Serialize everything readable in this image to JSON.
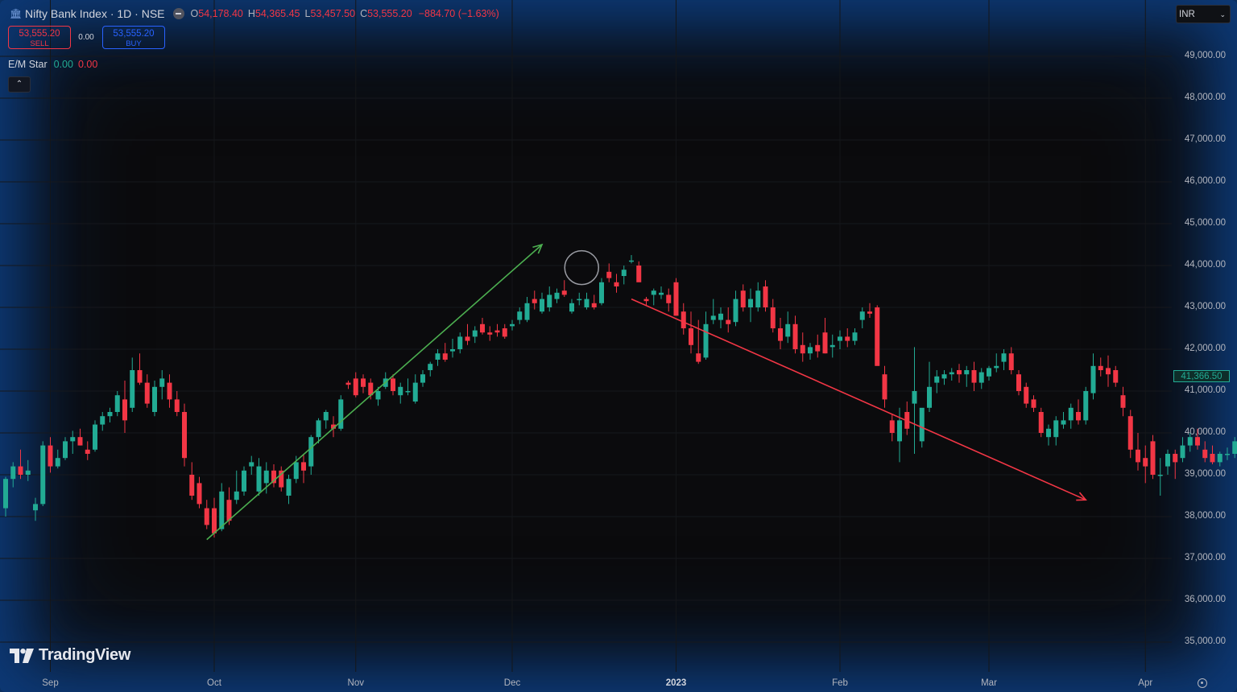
{
  "header": {
    "symbol_title": "Nifty Bank Index · 1D · NSE",
    "ohlc": {
      "o_label": "O",
      "o": "54,178.40",
      "h_label": "H",
      "h": "54,365.45",
      "l_label": "L",
      "l": "53,457.50",
      "c_label": "C",
      "c": "53,555.20",
      "change": "−884.70 (−1.63%)"
    }
  },
  "trade": {
    "sell_price": "53,555.20",
    "sell_label": "SELL",
    "spread": "0.00",
    "buy_price": "53,555.20",
    "buy_label": "BUY"
  },
  "indicator": {
    "name": "E/M Star",
    "value1": "0.00",
    "value2": "0.00"
  },
  "currency": {
    "label": "INR"
  },
  "last_price": "41,366.50",
  "logo": {
    "text": "TradingView"
  },
  "icons": [
    "bank-icon",
    "minus-icon",
    "chevron-up-icon",
    "chevron-down-icon",
    "tradingview-logo-icon",
    "settings-icon"
  ],
  "colors": {
    "up": "#22ab94",
    "down": "#f23645",
    "uptrend_arrow": "#4caf50",
    "downtrend_arrow": "#f23645",
    "background": "#0b0b0d",
    "frame_glow": "#0d3a78"
  },
  "chart_data": {
    "type": "candlestick",
    "y_ticks": [
      "49,000.00",
      "48,000.00",
      "47,000.00",
      "46,000.00",
      "45,000.00",
      "44,000.00",
      "43,000.00",
      "42,000.00",
      "41,000.00",
      "40,000.00",
      "39,000.00",
      "38,000.00",
      "37,000.00",
      "36,000.00",
      "35,000.00"
    ],
    "x_ticks": [
      "Sep",
      "Oct",
      "Nov",
      "Dec",
      "2023",
      "Feb",
      "Mar",
      "Apr"
    ],
    "ylim": [
      34200,
      49600
    ],
    "grid": true,
    "candles": [
      [
        38200,
        38950,
        38000,
        38900
      ],
      [
        38900,
        39300,
        38700,
        39200
      ],
      [
        39200,
        39600,
        38900,
        39000
      ],
      [
        39000,
        39350,
        38850,
        39100
      ],
      [
        38150,
        38450,
        37900,
        38300
      ],
      [
        38300,
        39800,
        38250,
        39700
      ],
      [
        39700,
        39900,
        39050,
        39200
      ],
      [
        39200,
        39600,
        39150,
        39400
      ],
      [
        39400,
        39900,
        39350,
        39800
      ],
      [
        39800,
        40050,
        39500,
        39900
      ],
      [
        39900,
        40100,
        39700,
        39700
      ],
      [
        39600,
        39800,
        39350,
        39500
      ],
      [
        39600,
        40300,
        39550,
        40200
      ],
      [
        40200,
        40500,
        40050,
        40400
      ],
      [
        40400,
        40600,
        40250,
        40500
      ],
      [
        40500,
        41000,
        40400,
        40900
      ],
      [
        40800,
        41250,
        40000,
        40300
      ],
      [
        40600,
        41800,
        40500,
        41500
      ],
      [
        41500,
        41900,
        41150,
        41200
      ],
      [
        41200,
        41400,
        40600,
        40700
      ],
      [
        40500,
        41250,
        40400,
        41100
      ],
      [
        41100,
        41500,
        40800,
        41300
      ],
      [
        41200,
        41400,
        40600,
        40800
      ],
      [
        40800,
        41000,
        40400,
        40500
      ],
      [
        40500,
        40700,
        39200,
        39400
      ],
      [
        39000,
        39300,
        38400,
        38500
      ],
      [
        38800,
        38950,
        38200,
        38300
      ],
      [
        38200,
        38400,
        37700,
        37800
      ],
      [
        38200,
        38450,
        37500,
        37600
      ],
      [
        37700,
        38800,
        37650,
        38600
      ],
      [
        38400,
        38700,
        37800,
        37900
      ],
      [
        38400,
        39100,
        38300,
        38600
      ],
      [
        38600,
        39200,
        38500,
        39100
      ],
      [
        39200,
        39450,
        39000,
        39300
      ],
      [
        38600,
        39400,
        38500,
        39200
      ],
      [
        38800,
        39300,
        38550,
        39100
      ],
      [
        39100,
        39250,
        38700,
        38800
      ],
      [
        39100,
        39200,
        38600,
        38700
      ],
      [
        38500,
        39000,
        38300,
        38900
      ],
      [
        38900,
        39450,
        38800,
        39300
      ],
      [
        39300,
        39500,
        38800,
        39100
      ],
      [
        39200,
        39950,
        39000,
        39900
      ],
      [
        39900,
        40350,
        39750,
        40300
      ],
      [
        40300,
        40550,
        40100,
        40500
      ],
      [
        40200,
        40400,
        39900,
        40100
      ],
      [
        40100,
        40900,
        40050,
        40800
      ],
      [
        41200,
        41250,
        41050,
        41150
      ],
      [
        41300,
        41450,
        40850,
        40900
      ],
      [
        41300,
        41400,
        40950,
        41100
      ],
      [
        41200,
        41300,
        40800,
        40900
      ],
      [
        40800,
        41100,
        40650,
        41000
      ],
      [
        41100,
        41450,
        41050,
        41300
      ],
      [
        41300,
        41400,
        40900,
        41000
      ],
      [
        40900,
        41200,
        40700,
        41100
      ],
      [
        41000,
        41300,
        40900,
        41000
      ],
      [
        40750,
        41400,
        40700,
        41200
      ],
      [
        41200,
        41500,
        41100,
        41400
      ],
      [
        41500,
        41700,
        41350,
        41650
      ],
      [
        41750,
        42000,
        41600,
        41900
      ],
      [
        41900,
        42150,
        41700,
        41750
      ],
      [
        41950,
        42250,
        41800,
        42000
      ],
      [
        42000,
        42400,
        41900,
        42300
      ],
      [
        42300,
        42600,
        42100,
        42200
      ],
      [
        42300,
        42550,
        42150,
        42450
      ],
      [
        42600,
        42750,
        42350,
        42400
      ],
      [
        42400,
        42550,
        42200,
        42350
      ],
      [
        42450,
        42600,
        42300,
        42400
      ],
      [
        42500,
        42600,
        42250,
        42300
      ],
      [
        42550,
        42700,
        42450,
        42600
      ],
      [
        42700,
        43000,
        42600,
        42900
      ],
      [
        42700,
        43250,
        42650,
        43100
      ],
      [
        43200,
        43400,
        42950,
        43100
      ],
      [
        42900,
        43350,
        42850,
        43200
      ],
      [
        43000,
        43500,
        42900,
        43300
      ],
      [
        43200,
        43450,
        43100,
        43350
      ],
      [
        43400,
        43650,
        43250,
        43300
      ],
      [
        42900,
        43200,
        42850,
        43100
      ],
      [
        43200,
        43350,
        43050,
        43200
      ],
      [
        43000,
        43350,
        42950,
        43200
      ],
      [
        43100,
        43300,
        42950,
        43000
      ],
      [
        43100,
        43700,
        43050,
        43600
      ],
      [
        43850,
        44050,
        43600,
        43700
      ],
      [
        43600,
        43800,
        43350,
        43500
      ],
      [
        43750,
        44000,
        43550,
        43900
      ],
      [
        44100,
        44250,
        44050,
        44120
      ],
      [
        44000,
        44100,
        43700,
        43600
      ],
      [
        43200,
        43250,
        43050,
        43150
      ],
      [
        43300,
        43450,
        43050,
        43400
      ],
      [
        43300,
        43500,
        43200,
        43350
      ],
      [
        43300,
        43450,
        42900,
        43100
      ],
      [
        43600,
        43700,
        42800,
        42800
      ],
      [
        42900,
        43100,
        42350,
        42500
      ],
      [
        42500,
        42900,
        41900,
        42100
      ],
      [
        41900,
        42700,
        41650,
        41700
      ],
      [
        41800,
        42900,
        41750,
        42600
      ],
      [
        42700,
        43200,
        42600,
        42800
      ],
      [
        42700,
        43000,
        42500,
        42850
      ],
      [
        42700,
        43000,
        42400,
        42600
      ],
      [
        42650,
        43400,
        42550,
        43200
      ],
      [
        43400,
        43550,
        42900,
        43000
      ],
      [
        43000,
        43450,
        42650,
        43200
      ],
      [
        43000,
        43600,
        42900,
        43400
      ],
      [
        43500,
        43650,
        42900,
        43000
      ],
      [
        43000,
        43200,
        42400,
        42500
      ],
      [
        42500,
        42750,
        42000,
        42200
      ],
      [
        42300,
        42900,
        42150,
        42600
      ],
      [
        42600,
        42800,
        41900,
        42000
      ],
      [
        42100,
        42400,
        41700,
        41900
      ],
      [
        41900,
        42150,
        41750,
        42050
      ],
      [
        42100,
        42350,
        41800,
        41950
      ],
      [
        42400,
        42750,
        41900,
        41900
      ],
      [
        42050,
        42350,
        41800,
        42100
      ],
      [
        42200,
        42450,
        42000,
        42300
      ],
      [
        42300,
        42500,
        42050,
        42200
      ],
      [
        42200,
        42500,
        42100,
        42400
      ],
      [
        42700,
        43000,
        42500,
        42900
      ],
      [
        42900,
        43100,
        42750,
        42850
      ],
      [
        43000,
        43050,
        42100,
        41600
      ],
      [
        41400,
        41600,
        40600,
        40800
      ],
      [
        40300,
        40450,
        39800,
        40000
      ],
      [
        39800,
        40600,
        39300,
        40300
      ],
      [
        40500,
        40750,
        39950,
        40100
      ],
      [
        40700,
        42050,
        39500,
        41000
      ],
      [
        39800,
        40400,
        39650,
        40600
      ],
      [
        40600,
        41700,
        40500,
        41100
      ],
      [
        41200,
        41500,
        40950,
        41350
      ],
      [
        41300,
        41500,
        41150,
        41400
      ],
      [
        41400,
        41550,
        41250,
        41450
      ],
      [
        41500,
        41650,
        41200,
        41400
      ],
      [
        41400,
        41600,
        41100,
        41500
      ],
      [
        41500,
        41700,
        41000,
        41200
      ],
      [
        41200,
        41550,
        41050,
        41450
      ],
      [
        41350,
        41600,
        41250,
        41550
      ],
      [
        41550,
        41900,
        41450,
        41600
      ],
      [
        41700,
        42000,
        41500,
        41900
      ],
      [
        41900,
        42050,
        41400,
        41500
      ],
      [
        41400,
        41500,
        40900,
        41000
      ],
      [
        41100,
        41200,
        40600,
        40700
      ],
      [
        40800,
        40900,
        40500,
        40600
      ],
      [
        40500,
        40600,
        39900,
        40000
      ],
      [
        39900,
        40200,
        39700,
        40100
      ],
      [
        39900,
        40400,
        39700,
        40300
      ],
      [
        40200,
        40500,
        40100,
        40300
      ],
      [
        40300,
        40700,
        40100,
        40600
      ],
      [
        40500,
        40800,
        40200,
        40300
      ],
      [
        40300,
        41100,
        40200,
        41000
      ],
      [
        40950,
        41900,
        40800,
        41600
      ],
      [
        41600,
        41800,
        41350,
        41500
      ],
      [
        41550,
        41850,
        41100,
        41400
      ],
      [
        41500,
        41600,
        41100,
        41200
      ],
      [
        40900,
        41100,
        40400,
        40600
      ],
      [
        40400,
        40550,
        39400,
        39600
      ],
      [
        39600,
        40000,
        39100,
        39300
      ],
      [
        39400,
        39700,
        38800,
        39200
      ],
      [
        39800,
        39950,
        38900,
        39000
      ],
      [
        39000,
        39400,
        38500,
        39000
      ],
      [
        39200,
        39600,
        39000,
        39500
      ],
      [
        39500,
        39600,
        38900,
        39300
      ],
      [
        39400,
        39900,
        39300,
        39700
      ],
      [
        39700,
        40000,
        39550,
        39900
      ],
      [
        39900,
        40100,
        39600,
        39700
      ],
      [
        39600,
        39800,
        39300,
        39400
      ],
      [
        39500,
        39700,
        39250,
        39300
      ],
      [
        39300,
        39550,
        39200,
        39500
      ],
      [
        39500,
        39650,
        39350,
        39500
      ],
      [
        39500,
        39900,
        39400,
        39800
      ],
      [
        39900,
        40400,
        39800,
        40300
      ],
      [
        40400,
        40600,
        40150,
        40500
      ],
      [
        40700,
        40950,
        40500,
        40800
      ],
      [
        41000,
        41200,
        40700,
        40900
      ],
      [
        40800,
        41200,
        40700,
        41000
      ],
      [
        41100,
        41200,
        40800,
        40800
      ],
      [
        40900,
        41450,
        40800,
        41150
      ]
    ],
    "annotations": [
      {
        "type": "arrow",
        "color": "#4caf50",
        "from": [
          27,
          37450
        ],
        "to": [
          72,
          44500
        ]
      },
      {
        "type": "arrow",
        "color": "#f23645",
        "from": [
          84,
          43200
        ],
        "to": [
          145,
          38400
        ]
      },
      {
        "type": "circle",
        "at": [
          77,
          43950
        ]
      }
    ]
  }
}
